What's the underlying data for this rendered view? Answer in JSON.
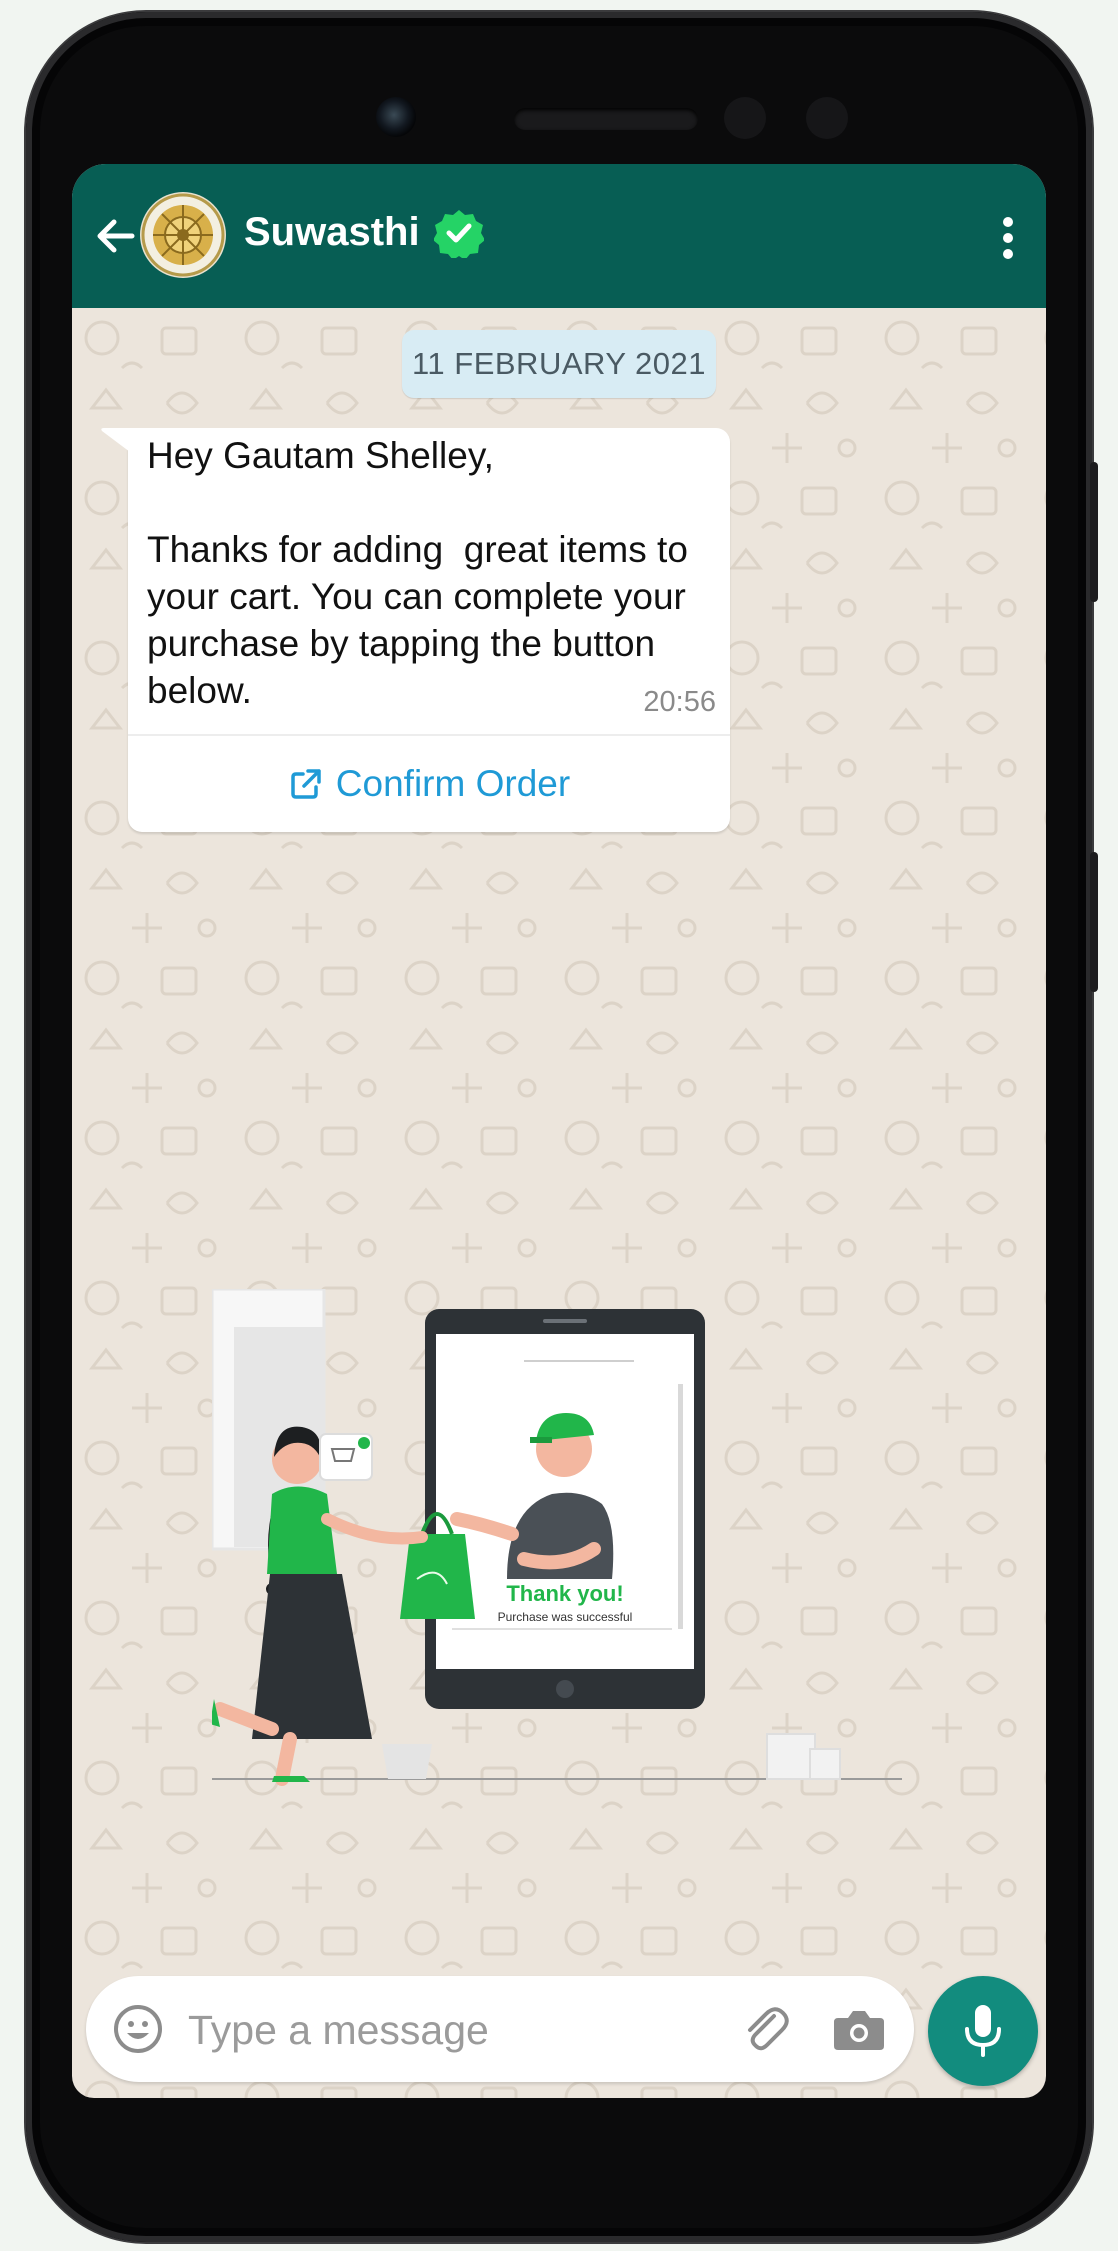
{
  "header": {
    "contact_name": "Suwasthi",
    "verified": true,
    "accent_color": "#075e54"
  },
  "chat": {
    "date_chip": "11 FEBRUARY 2021",
    "messages": [
      {
        "text": "Hey Gautam Shelley,\n\nThanks for adding  great items to your cart. You can complete your purchase by tapping the button below.",
        "time": "20:56",
        "cta_label": "Confirm Order",
        "cta_icon": "external-link-icon"
      }
    ]
  },
  "illustration": {
    "thank_you": "Thank you!",
    "purchase_text": "Purchase was successful"
  },
  "composer": {
    "placeholder": "Type a message"
  },
  "icons": [
    "back-arrow-icon",
    "verified-badge-icon",
    "more-vertical-icon",
    "emoji-icon",
    "paperclip-icon",
    "camera-icon",
    "microphone-icon"
  ]
}
